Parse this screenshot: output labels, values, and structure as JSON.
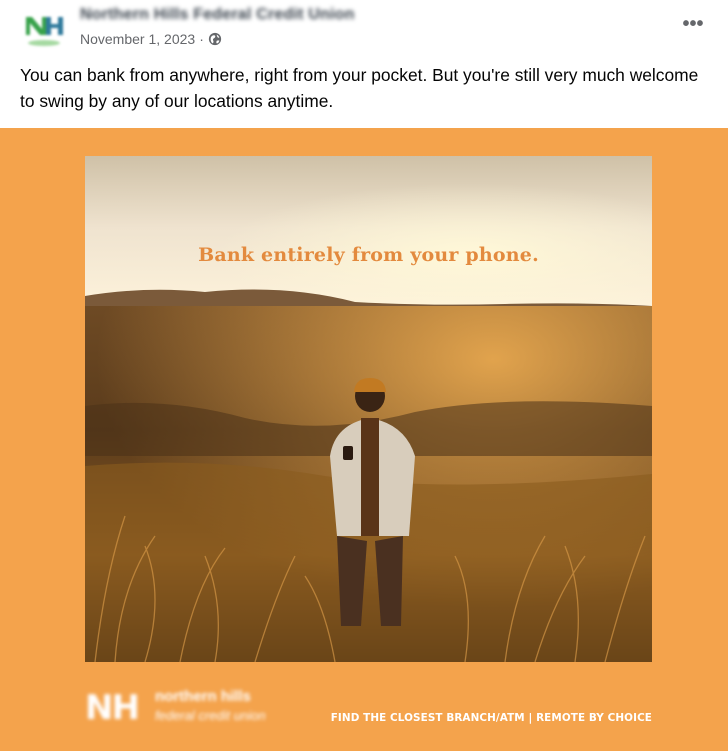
{
  "post": {
    "page_name": "Northern Hills Federal Credit Union",
    "date": "November 1, 2023",
    "separator": "·",
    "privacy_icon": "globe-icon",
    "more_icon": "more-options-icon",
    "caption": "You can bank from anywhere, right from your pocket. But you're still very much welcome to swing by any of our locations anytime."
  },
  "creative": {
    "background_color": "#f4a34c",
    "headline": "Bank entirely from your phone.",
    "headline_color": "#e38a3e",
    "logo_mark": "NH",
    "logo_word1": "northern hills",
    "logo_word2": "federal credit union",
    "footer_cta": "FIND THE CLOSEST BRANCH/ATM | REMOTE BY CHOICE"
  }
}
